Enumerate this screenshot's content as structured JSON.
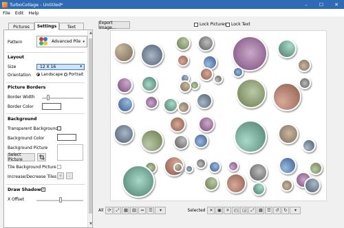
{
  "window": {
    "title": "TurboCollage - Untitled*",
    "minimize_glyph": "–",
    "maximize_glyph": "☐",
    "close_glyph": "✕"
  },
  "menu": [
    "File",
    "Edit",
    "Help"
  ],
  "tabs": [
    "Pictures",
    "Settings",
    "Text"
  ],
  "settings": {
    "pattern_label": "Pattern",
    "pattern_value": "Advanced Pile",
    "layout_section": "Layout",
    "size_label": "Size",
    "size_value": "12 X 16",
    "orientation_label": "Orientation",
    "orientation_options": [
      "Landscape",
      "Portrait"
    ],
    "orientation_selected": "Landscape",
    "picture_borders_section": "Picture Borders",
    "border_width_label": "Border Width",
    "border_color_label": "Border Color",
    "background_section": "Background",
    "transparent_background_label": "Transparent Background",
    "background_color_label": "Background Color",
    "background_picture_label": "Background Picture",
    "select_picture_label": "Select Picture",
    "tile_background_label": "Tile Background Picture",
    "increase_decrease_label": "Increase/Decrease Tiles",
    "plus_label": "+",
    "minus_label": "-",
    "draw_shadows_label": "Draw Shadows",
    "draw_shadows_checked": true,
    "x_offset_label": "X Offset"
  },
  "top": {
    "export_label": "Export Image...",
    "lock_pictures_label": "Lock Pictures",
    "lock_text_label": "Lock Text"
  },
  "bottom_toolbar": {
    "all_label": "All",
    "selected_label": "Selected",
    "all_icons": [
      "rotate-icon",
      "fit-icon",
      "grid-icon",
      "grid-small-icon",
      "equal-icon",
      "align-icon",
      "more-dropdown-icon"
    ],
    "selected_icons": [
      "delete-icon",
      "image-icon",
      "crop-icon",
      "bring-front-icon",
      "send-back-icon",
      "fit-icon",
      "grid-icon",
      "align-icon",
      "rotate-left-icon",
      "rotate-right-icon",
      "more-dropdown-icon"
    ]
  },
  "colors": {
    "titlebar": "#2f6bb5",
    "selection": "#cfe3f8",
    "canvas": "#ffffff"
  }
}
